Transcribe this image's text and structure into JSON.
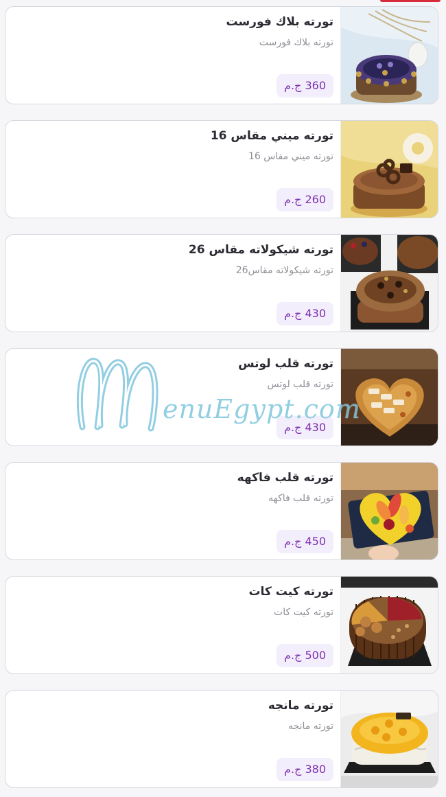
{
  "colors": {
    "accent": "#d62c3c",
    "price_text": "#7d2fb0",
    "price_bg": "#f3eefb",
    "title_text": "#2b2b33",
    "desc_text": "#8e8e96",
    "watermark": "#7fc6dd"
  },
  "watermark": {
    "text": "enuEgypt.com"
  },
  "items": [
    {
      "title": "تورته بلاك فورست",
      "description": "تورته بلاك فورست",
      "price": "360 ج.م",
      "image_icon": "black-forest-cake-photo"
    },
    {
      "title": "تورته ميني مقاس 16",
      "description": "تورته ميني مقاس 16",
      "price": "260 ج.م",
      "image_icon": "mini-chocolate-cake-photo"
    },
    {
      "title": "تورته شيكولاته مقاس 26",
      "description": "تورته شيكولاته مقاس26",
      "price": "430 ج.م",
      "image_icon": "chocolate-cake-photo"
    },
    {
      "title": "تورته قلب لوتس",
      "description": "تورته قلب لوتس",
      "price": "430 ج.م",
      "image_icon": "lotus-heart-cake-photo"
    },
    {
      "title": "تورته قلب فاكهه",
      "description": "تورته قلب فاكهه",
      "price": "450 ج.م",
      "image_icon": "fruit-heart-cake-photo"
    },
    {
      "title": "تورته كيت كات",
      "description": "تورته كيت كات",
      "price": "500 ج.م",
      "image_icon": "kitkat-cake-photo"
    },
    {
      "title": "تورته مانجه",
      "description": "تورته مانجه",
      "price": "380 ج.م",
      "image_icon": "mango-cake-photo"
    }
  ]
}
